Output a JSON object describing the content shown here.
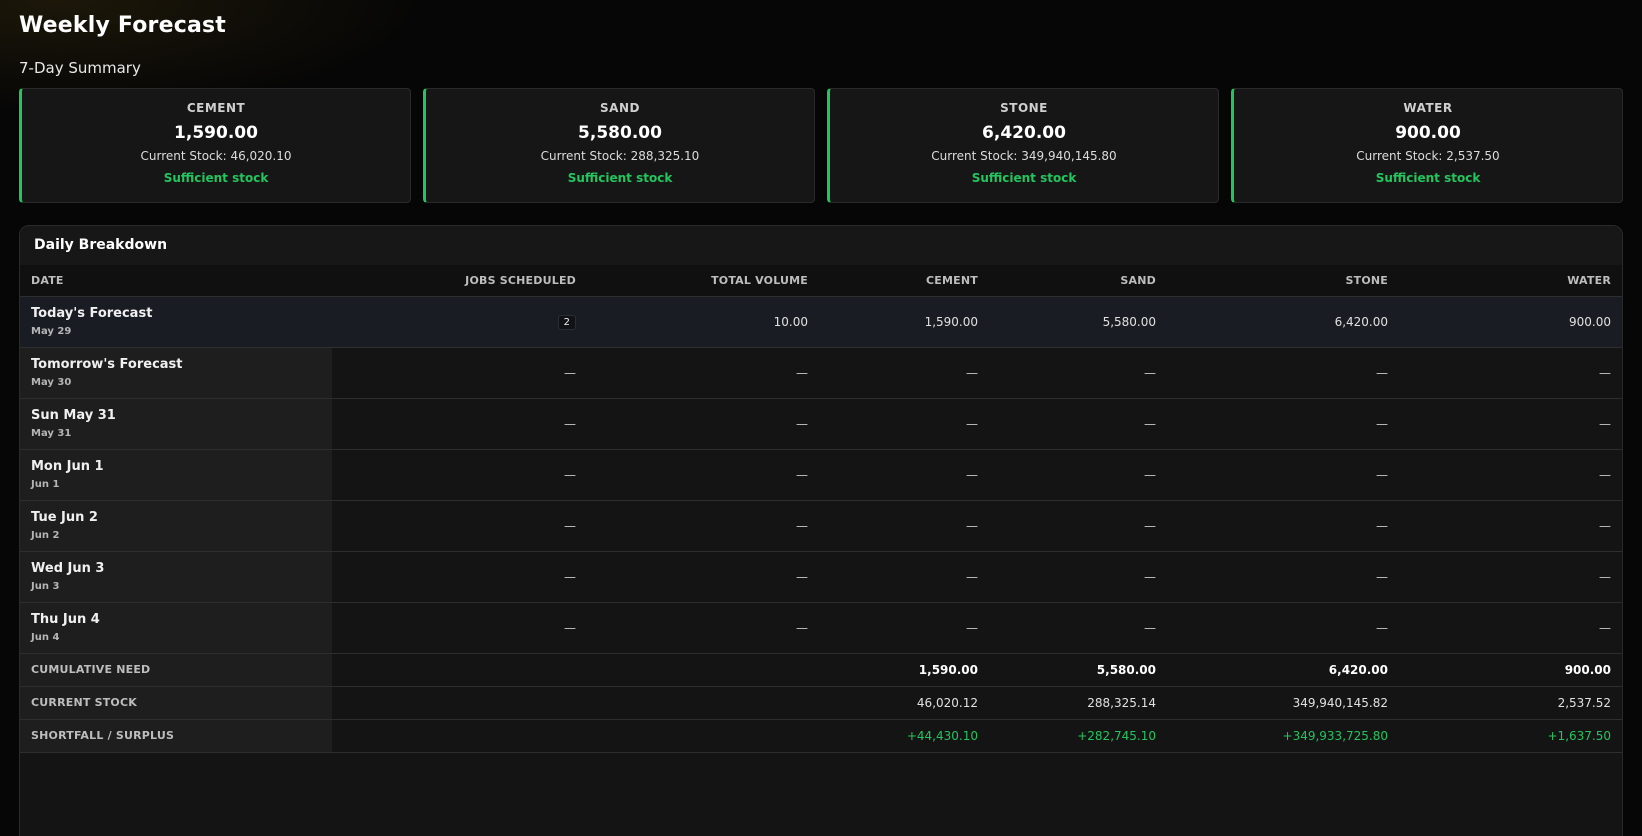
{
  "page": {
    "title": "Weekly Forecast",
    "summary_title": "7-Day Summary"
  },
  "colors": {
    "accent": "#22c55e",
    "background": "#060606",
    "card": "#161616"
  },
  "summary_cards": [
    {
      "name": "CEMENT",
      "value": "1,590.00",
      "stock": "Current Stock: 46,020.10",
      "status": "Sufficient stock"
    },
    {
      "name": "SAND",
      "value": "5,580.00",
      "stock": "Current Stock: 288,325.10",
      "status": "Sufficient stock"
    },
    {
      "name": "STONE",
      "value": "6,420.00",
      "stock": "Current Stock: 349,940,145.80",
      "status": "Sufficient stock"
    },
    {
      "name": "WATER",
      "value": "900.00",
      "stock": "Current Stock: 2,537.50",
      "status": "Sufficient stock"
    }
  ],
  "breakdown": {
    "title": "Daily Breakdown",
    "columns": [
      "DATE",
      "JOBS SCHEDULED",
      "TOTAL VOLUME",
      "CEMENT",
      "SAND",
      "STONE",
      "WATER"
    ],
    "rows": [
      {
        "name": "Today's Forecast",
        "sub": "May 29",
        "jobs": "2",
        "volume": "10.00",
        "cement": "1,590.00",
        "sand": "5,580.00",
        "stone": "6,420.00",
        "water": "900.00"
      },
      {
        "name": "Tomorrow's Forecast",
        "sub": "May 30",
        "jobs": "—",
        "volume": "—",
        "cement": "—",
        "sand": "—",
        "stone": "—",
        "water": "—"
      },
      {
        "name": "Sun May 31",
        "sub": "May 31",
        "jobs": "—",
        "volume": "—",
        "cement": "—",
        "sand": "—",
        "stone": "—",
        "water": "—"
      },
      {
        "name": "Mon Jun 1",
        "sub": "Jun 1",
        "jobs": "—",
        "volume": "—",
        "cement": "—",
        "sand": "—",
        "stone": "—",
        "water": "—"
      },
      {
        "name": "Tue Jun 2",
        "sub": "Jun 2",
        "jobs": "—",
        "volume": "—",
        "cement": "—",
        "sand": "—",
        "stone": "—",
        "water": "—"
      },
      {
        "name": "Wed Jun 3",
        "sub": "Jun 3",
        "jobs": "—",
        "volume": "—",
        "cement": "—",
        "sand": "—",
        "stone": "—",
        "water": "—"
      },
      {
        "name": "Thu Jun 4",
        "sub": "Jun 4",
        "jobs": "—",
        "volume": "—",
        "cement": "—",
        "sand": "—",
        "stone": "—",
        "water": "—"
      }
    ],
    "summary_rows": [
      {
        "label": "CUMULATIVE NEED",
        "cement": "1,590.00",
        "sand": "5,580.00",
        "stone": "6,420.00",
        "water": "900.00"
      },
      {
        "label": "CURRENT STOCK",
        "cement": "46,020.12",
        "sand": "288,325.14",
        "stone": "349,940,145.82",
        "water": "2,537.52"
      },
      {
        "label": "SHORTFALL / SURPLUS",
        "cement": "+44,430.10",
        "sand": "+282,745.10",
        "stone": "+349,933,725.80",
        "water": "+1,637.50"
      }
    ]
  }
}
